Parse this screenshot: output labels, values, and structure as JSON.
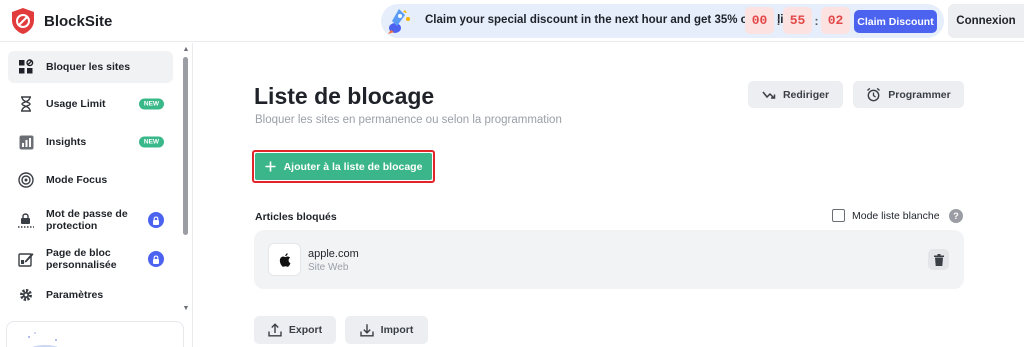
{
  "app": {
    "name": "BlockSite",
    "brand_color": "#e23b3b",
    "accent_green": "#3bb58a",
    "accent_blue": "#4c63f0"
  },
  "promo_bar": {
    "message": "Claim your special discount in the next hour and get 35% off for life!",
    "timer": {
      "hours": "00",
      "minutes": "55",
      "seconds": "02",
      "separator": ":"
    },
    "claim_label": "Claim Discount"
  },
  "header": {
    "login_label": "Connexion"
  },
  "sidebar": {
    "items": [
      {
        "label": "Bloquer les sites",
        "icon": "grid-block-icon",
        "active": true
      },
      {
        "label": "Usage Limit",
        "icon": "hourglass-icon",
        "badge": "NEW"
      },
      {
        "label": "Insights",
        "icon": "bar-chart-icon",
        "badge": "NEW"
      },
      {
        "label": "Mode Focus",
        "icon": "target-icon"
      },
      {
        "label": "Mot de passe de protection",
        "icon": "password-lock-icon",
        "locked": true
      },
      {
        "label": "Page de bloc personnalisée",
        "icon": "edit-page-icon",
        "locked": true
      },
      {
        "label": "Paramètres",
        "icon": "gear-icon"
      }
    ]
  },
  "main": {
    "title": "Liste de blocage",
    "subtitle": "Bloquer les sites en permanence ou selon la programmation",
    "redirect_label": "Rediriger",
    "schedule_label": "Programmer",
    "add_label": "Ajouter à la liste de blocage",
    "blocked_section_label": "Articles bloqués",
    "whitelist_label": "Mode liste blanche",
    "whitelist_checked": false,
    "help_symbol": "?",
    "blocked_items": [
      {
        "name": "apple.com",
        "type": "Site Web",
        "icon": "apple-icon"
      }
    ],
    "export_label": "Export",
    "import_label": "Import"
  }
}
